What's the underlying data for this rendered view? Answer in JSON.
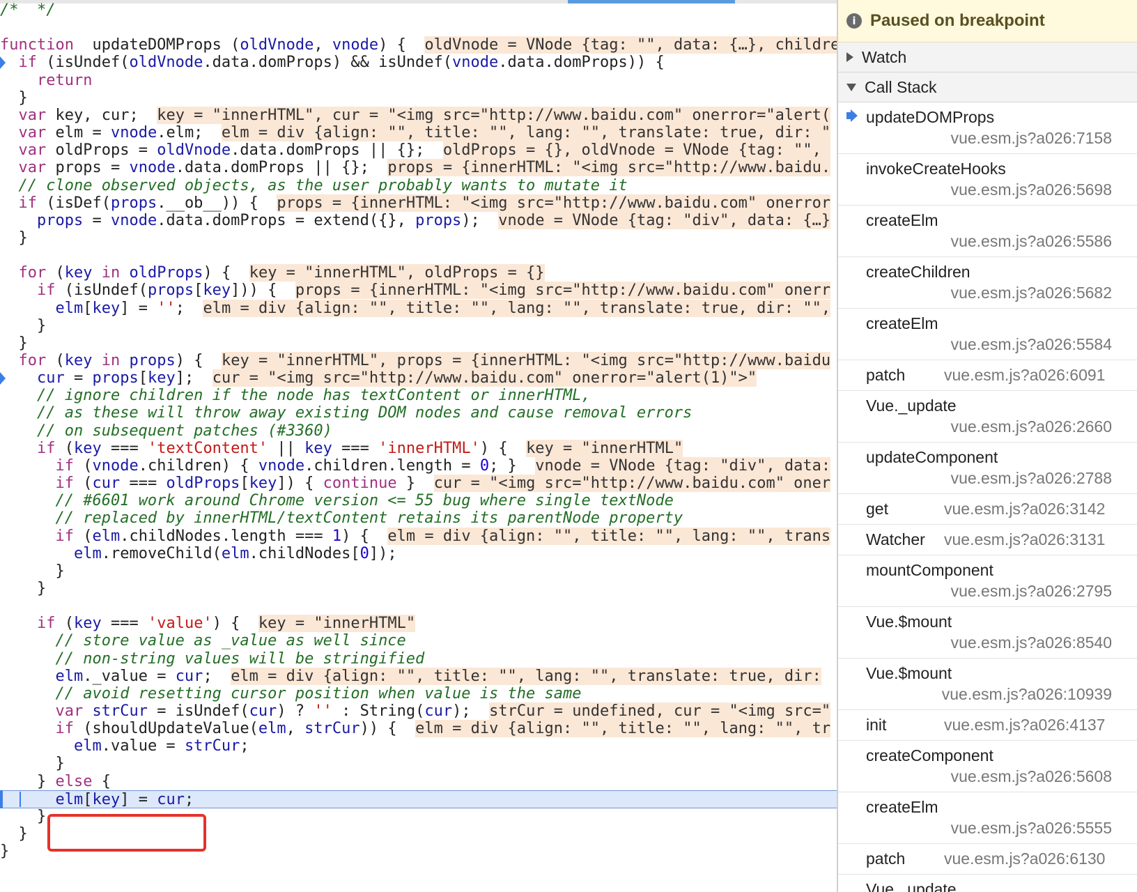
{
  "editor": {
    "lines": [
      [
        [
          "cm",
          "/*  */"
        ]
      ],
      [],
      [
        [
          "kw",
          "function"
        ],
        [
          "",
          "  "
        ],
        [
          "fn",
          "updateDOMProps"
        ],
        [
          "",
          " ("
        ],
        [
          "var",
          "oldVnode"
        ],
        [
          "",
          ", "
        ],
        [
          "var",
          "vnode"
        ],
        [
          "",
          ") {  "
        ],
        [
          "val",
          "oldVnode = VNode {tag: \"\", data: {…}, childre"
        ]
      ],
      [
        [
          "",
          "  "
        ],
        [
          "kw",
          "if"
        ],
        [
          "",
          " (isUndef("
        ],
        [
          "var",
          "oldVnode"
        ],
        [
          "",
          ".data.domProps) && isUndef("
        ],
        [
          "var",
          "vnode"
        ],
        [
          "",
          ".data.domProps)) {"
        ]
      ],
      [
        [
          "",
          "    "
        ],
        [
          "kw",
          "return"
        ]
      ],
      [
        [
          "",
          "  }"
        ]
      ],
      [
        [
          "",
          "  "
        ],
        [
          "kw",
          "var"
        ],
        [
          "",
          " key, cur;  "
        ],
        [
          "val",
          "key = \"innerHTML\", cur = \"<img src=\"http://www.baidu.com\" onerror=\"alert("
        ]
      ],
      [
        [
          "",
          "  "
        ],
        [
          "kw",
          "var"
        ],
        [
          "",
          " elm = "
        ],
        [
          "var",
          "vnode"
        ],
        [
          "",
          ".elm;  "
        ],
        [
          "val",
          "elm = div {align: \"\", title: \"\", lang: \"\", translate: true, dir: \""
        ]
      ],
      [
        [
          "",
          "  "
        ],
        [
          "kw",
          "var"
        ],
        [
          "",
          " oldProps = "
        ],
        [
          "var",
          "oldVnode"
        ],
        [
          "",
          ".data.domProps || {};  "
        ],
        [
          "val",
          "oldProps = {}, oldVnode = VNode {tag: \"\", "
        ]
      ],
      [
        [
          "",
          "  "
        ],
        [
          "kw",
          "var"
        ],
        [
          "",
          " props = "
        ],
        [
          "var",
          "vnode"
        ],
        [
          "",
          ".data.domProps || {};  "
        ],
        [
          "val",
          "props = {innerHTML: \"<img src=\"http://www.baidu."
        ]
      ],
      [
        [
          "",
          "  "
        ],
        [
          "cm",
          "// clone observed objects, as the user probably wants to mutate it"
        ]
      ],
      [
        [
          "",
          "  "
        ],
        [
          "kw",
          "if"
        ],
        [
          "",
          " (isDef("
        ],
        [
          "var",
          "props"
        ],
        [
          "",
          ".__ob__)) {  "
        ],
        [
          "val",
          "props = {innerHTML: \"<img src=\"http://www.baidu.com\" onerror"
        ]
      ],
      [
        [
          "",
          "    "
        ],
        [
          "var",
          "props"
        ],
        [
          "",
          " = "
        ],
        [
          "var",
          "vnode"
        ],
        [
          "",
          ".data.domProps = extend({}, "
        ],
        [
          "var",
          "props"
        ],
        [
          "",
          ");  "
        ],
        [
          "val",
          "vnode = VNode {tag: \"div\", data: {…}"
        ]
      ],
      [
        [
          "",
          "  }"
        ]
      ],
      [],
      [
        [
          "",
          "  "
        ],
        [
          "kw",
          "for"
        ],
        [
          "",
          " ("
        ],
        [
          "var",
          "key"
        ],
        [
          "",
          " "
        ],
        [
          "kw",
          "in"
        ],
        [
          "",
          " "
        ],
        [
          "var",
          "oldProps"
        ],
        [
          "",
          ") {  "
        ],
        [
          "val",
          "key = \"innerHTML\", oldProps = {}"
        ]
      ],
      [
        [
          "",
          "    "
        ],
        [
          "kw",
          "if"
        ],
        [
          "",
          " (isUndef("
        ],
        [
          "var",
          "props"
        ],
        [
          "",
          "["
        ],
        [
          "var",
          "key"
        ],
        [
          "",
          "])) {  "
        ],
        [
          "val",
          "props = {innerHTML: \"<img src=\"http://www.baidu.com\" onerr"
        ]
      ],
      [
        [
          "",
          "      "
        ],
        [
          "var",
          "elm"
        ],
        [
          "",
          "["
        ],
        [
          "var",
          "key"
        ],
        [
          "",
          "] = "
        ],
        [
          "str",
          "''"
        ],
        [
          "",
          ";  "
        ],
        [
          "val",
          "elm = div {align: \"\", title: \"\", lang: \"\", translate: true, dir: \"\","
        ]
      ],
      [
        [
          "",
          "    }"
        ]
      ],
      [
        [
          "",
          "  }"
        ]
      ],
      [
        [
          "",
          "  "
        ],
        [
          "kw",
          "for"
        ],
        [
          "",
          " ("
        ],
        [
          "var",
          "key"
        ],
        [
          "",
          " "
        ],
        [
          "kw",
          "in"
        ],
        [
          "",
          " "
        ],
        [
          "var",
          "props"
        ],
        [
          "",
          ") {  "
        ],
        [
          "val",
          "key = \"innerHTML\", props = {innerHTML: \"<img src=\"http://www.baidu"
        ]
      ],
      [
        [
          "",
          "    "
        ],
        [
          "var",
          "cur"
        ],
        [
          "",
          " = "
        ],
        [
          "var",
          "props"
        ],
        [
          "",
          "["
        ],
        [
          "var",
          "key"
        ],
        [
          "",
          "];  "
        ],
        [
          "val",
          "cur = \"<img src=\"http://www.baidu.com\" onerror=\"alert(1)\">\""
        ]
      ],
      [
        [
          "",
          "    "
        ],
        [
          "cm",
          "// ignore children if the node has textContent or innerHTML,"
        ]
      ],
      [
        [
          "",
          "    "
        ],
        [
          "cm",
          "// as these will throw away existing DOM nodes and cause removal errors"
        ]
      ],
      [
        [
          "",
          "    "
        ],
        [
          "cm",
          "// on subsequent patches (#3360)"
        ]
      ],
      [
        [
          "",
          "    "
        ],
        [
          "kw",
          "if"
        ],
        [
          "",
          " ("
        ],
        [
          "var",
          "key"
        ],
        [
          "",
          " === "
        ],
        [
          "str",
          "'textContent'"
        ],
        [
          "",
          " || "
        ],
        [
          "var",
          "key"
        ],
        [
          "",
          " === "
        ],
        [
          "str",
          "'innerHTML'"
        ],
        [
          "",
          ") {  "
        ],
        [
          "val",
          "key = \"innerHTML\""
        ]
      ],
      [
        [
          "",
          "      "
        ],
        [
          "kw",
          "if"
        ],
        [
          "",
          " ("
        ],
        [
          "var",
          "vnode"
        ],
        [
          "",
          ".children) { "
        ],
        [
          "var",
          "vnode"
        ],
        [
          "",
          ".children.length = "
        ],
        [
          "num",
          "0"
        ],
        [
          "",
          "; }  "
        ],
        [
          "val",
          "vnode = VNode {tag: \"div\", data:"
        ]
      ],
      [
        [
          "",
          "      "
        ],
        [
          "kw",
          "if"
        ],
        [
          "",
          " ("
        ],
        [
          "var",
          "cur"
        ],
        [
          "",
          " === "
        ],
        [
          "var",
          "oldProps"
        ],
        [
          "",
          "["
        ],
        [
          "var",
          "key"
        ],
        [
          "",
          "]) { "
        ],
        [
          "kw",
          "continue"
        ],
        [
          "",
          " }  "
        ],
        [
          "val",
          "cur = \"<img src=\"http://www.baidu.com\" oner"
        ]
      ],
      [
        [
          "",
          "      "
        ],
        [
          "cm",
          "// #6601 work around Chrome version <= 55 bug where single textNode"
        ]
      ],
      [
        [
          "",
          "      "
        ],
        [
          "cm",
          "// replaced by innerHTML/textContent retains its parentNode property"
        ]
      ],
      [
        [
          "",
          "      "
        ],
        [
          "kw",
          "if"
        ],
        [
          "",
          " ("
        ],
        [
          "var",
          "elm"
        ],
        [
          "",
          ".childNodes.length === "
        ],
        [
          "num",
          "1"
        ],
        [
          "",
          ") {  "
        ],
        [
          "val",
          "elm = div {align: \"\", title: \"\", lang: \"\", trans"
        ]
      ],
      [
        [
          "",
          "        "
        ],
        [
          "var",
          "elm"
        ],
        [
          "",
          ".removeChild("
        ],
        [
          "var",
          "elm"
        ],
        [
          "",
          ".childNodes["
        ],
        [
          "num",
          "0"
        ],
        [
          "",
          "]);"
        ]
      ],
      [
        [
          "",
          "      }"
        ]
      ],
      [
        [
          "",
          "    }"
        ]
      ],
      [],
      [
        [
          "",
          "    "
        ],
        [
          "kw",
          "if"
        ],
        [
          "",
          " ("
        ],
        [
          "var",
          "key"
        ],
        [
          "",
          " === "
        ],
        [
          "str",
          "'value'"
        ],
        [
          "",
          ") {  "
        ],
        [
          "val",
          "key = \"innerHTML\""
        ]
      ],
      [
        [
          "",
          "      "
        ],
        [
          "cm",
          "// store value as _value as well since"
        ]
      ],
      [
        [
          "",
          "      "
        ],
        [
          "cm",
          "// non-string values will be stringified"
        ]
      ],
      [
        [
          "",
          "      "
        ],
        [
          "var",
          "elm"
        ],
        [
          "",
          "._value = "
        ],
        [
          "var",
          "cur"
        ],
        [
          "",
          ";  "
        ],
        [
          "val",
          "elm = div {align: \"\", title: \"\", lang: \"\", translate: true, dir:"
        ]
      ],
      [
        [
          "",
          "      "
        ],
        [
          "cm",
          "// avoid resetting cursor position when value is the same"
        ]
      ],
      [
        [
          "",
          "      "
        ],
        [
          "kw",
          "var"
        ],
        [
          "",
          " "
        ],
        [
          "var",
          "strCur"
        ],
        [
          "",
          " = isUndef("
        ],
        [
          "var",
          "cur"
        ],
        [
          "",
          ") ? "
        ],
        [
          "str",
          "''"
        ],
        [
          "",
          " : String("
        ],
        [
          "var",
          "cur"
        ],
        [
          "",
          ");  "
        ],
        [
          "val",
          "strCur = undefined, cur = \"<img src=\""
        ]
      ],
      [
        [
          "",
          "      "
        ],
        [
          "kw",
          "if"
        ],
        [
          "",
          " (shouldUpdateValue("
        ],
        [
          "var",
          "elm"
        ],
        [
          "",
          ", "
        ],
        [
          "var",
          "strCur"
        ],
        [
          "",
          ")) {  "
        ],
        [
          "val",
          "elm = div {align: \"\", title: \"\", lang: \"\", tr"
        ]
      ],
      [
        [
          "",
          "        "
        ],
        [
          "var",
          "elm"
        ],
        [
          "",
          ".value = "
        ],
        [
          "var",
          "strCur"
        ],
        [
          "",
          ";"
        ]
      ],
      [
        [
          "",
          "      }"
        ]
      ],
      [
        [
          "",
          "    } "
        ],
        [
          "kw",
          "else"
        ],
        [
          "",
          " {"
        ]
      ],
      [
        [
          "",
          "      "
        ],
        [
          "var",
          "elm"
        ],
        [
          "",
          "["
        ],
        [
          "var",
          "key"
        ],
        [
          "",
          "] = "
        ],
        [
          "var",
          "cur"
        ],
        [
          "",
          ";"
        ]
      ],
      [
        [
          "",
          "    }"
        ]
      ],
      [
        [
          "",
          "  }"
        ]
      ],
      [
        [
          "",
          "}"
        ]
      ]
    ]
  },
  "debugger": {
    "paused_icon": "info-icon",
    "paused_text": "Paused on breakpoint",
    "watch_label": "Watch",
    "callstack_label": "Call Stack",
    "frames": [
      {
        "name": "updateDOMProps",
        "location": "vue.esm.js?a026:7158",
        "layout": "two",
        "current": true
      },
      {
        "name": "invokeCreateHooks",
        "location": "vue.esm.js?a026:5698",
        "layout": "two"
      },
      {
        "name": "createElm",
        "location": "vue.esm.js?a026:5586",
        "layout": "two"
      },
      {
        "name": "createChildren",
        "location": "vue.esm.js?a026:5682",
        "layout": "two"
      },
      {
        "name": "createElm",
        "location": "vue.esm.js?a026:5584",
        "layout": "two"
      },
      {
        "name": "patch",
        "location": "vue.esm.js?a026:6091",
        "layout": "one"
      },
      {
        "name": "Vue._update",
        "location": "vue.esm.js?a026:2660",
        "layout": "two"
      },
      {
        "name": "updateComponent",
        "location": "vue.esm.js?a026:2788",
        "layout": "two"
      },
      {
        "name": "get",
        "location": "vue.esm.js?a026:3142",
        "layout": "one"
      },
      {
        "name": "Watcher",
        "location": "vue.esm.js?a026:3131",
        "layout": "one"
      },
      {
        "name": "mountComponent",
        "location": "vue.esm.js?a026:2795",
        "layout": "two"
      },
      {
        "name": "Vue.$mount",
        "location": "vue.esm.js?a026:8540",
        "layout": "two"
      },
      {
        "name": "Vue.$mount",
        "location": "vue.esm.js?a026:10939",
        "layout": "two"
      },
      {
        "name": "init",
        "location": "vue.esm.js?a026:4137",
        "layout": "one"
      },
      {
        "name": "createComponent",
        "location": "vue.esm.js?a026:5608",
        "layout": "two"
      },
      {
        "name": "createElm",
        "location": "vue.esm.js?a026:5555",
        "layout": "two"
      },
      {
        "name": "patch",
        "location": "vue.esm.js?a026:6130",
        "layout": "one"
      },
      {
        "name": "Vue._update",
        "location": "",
        "layout": "two"
      }
    ]
  }
}
